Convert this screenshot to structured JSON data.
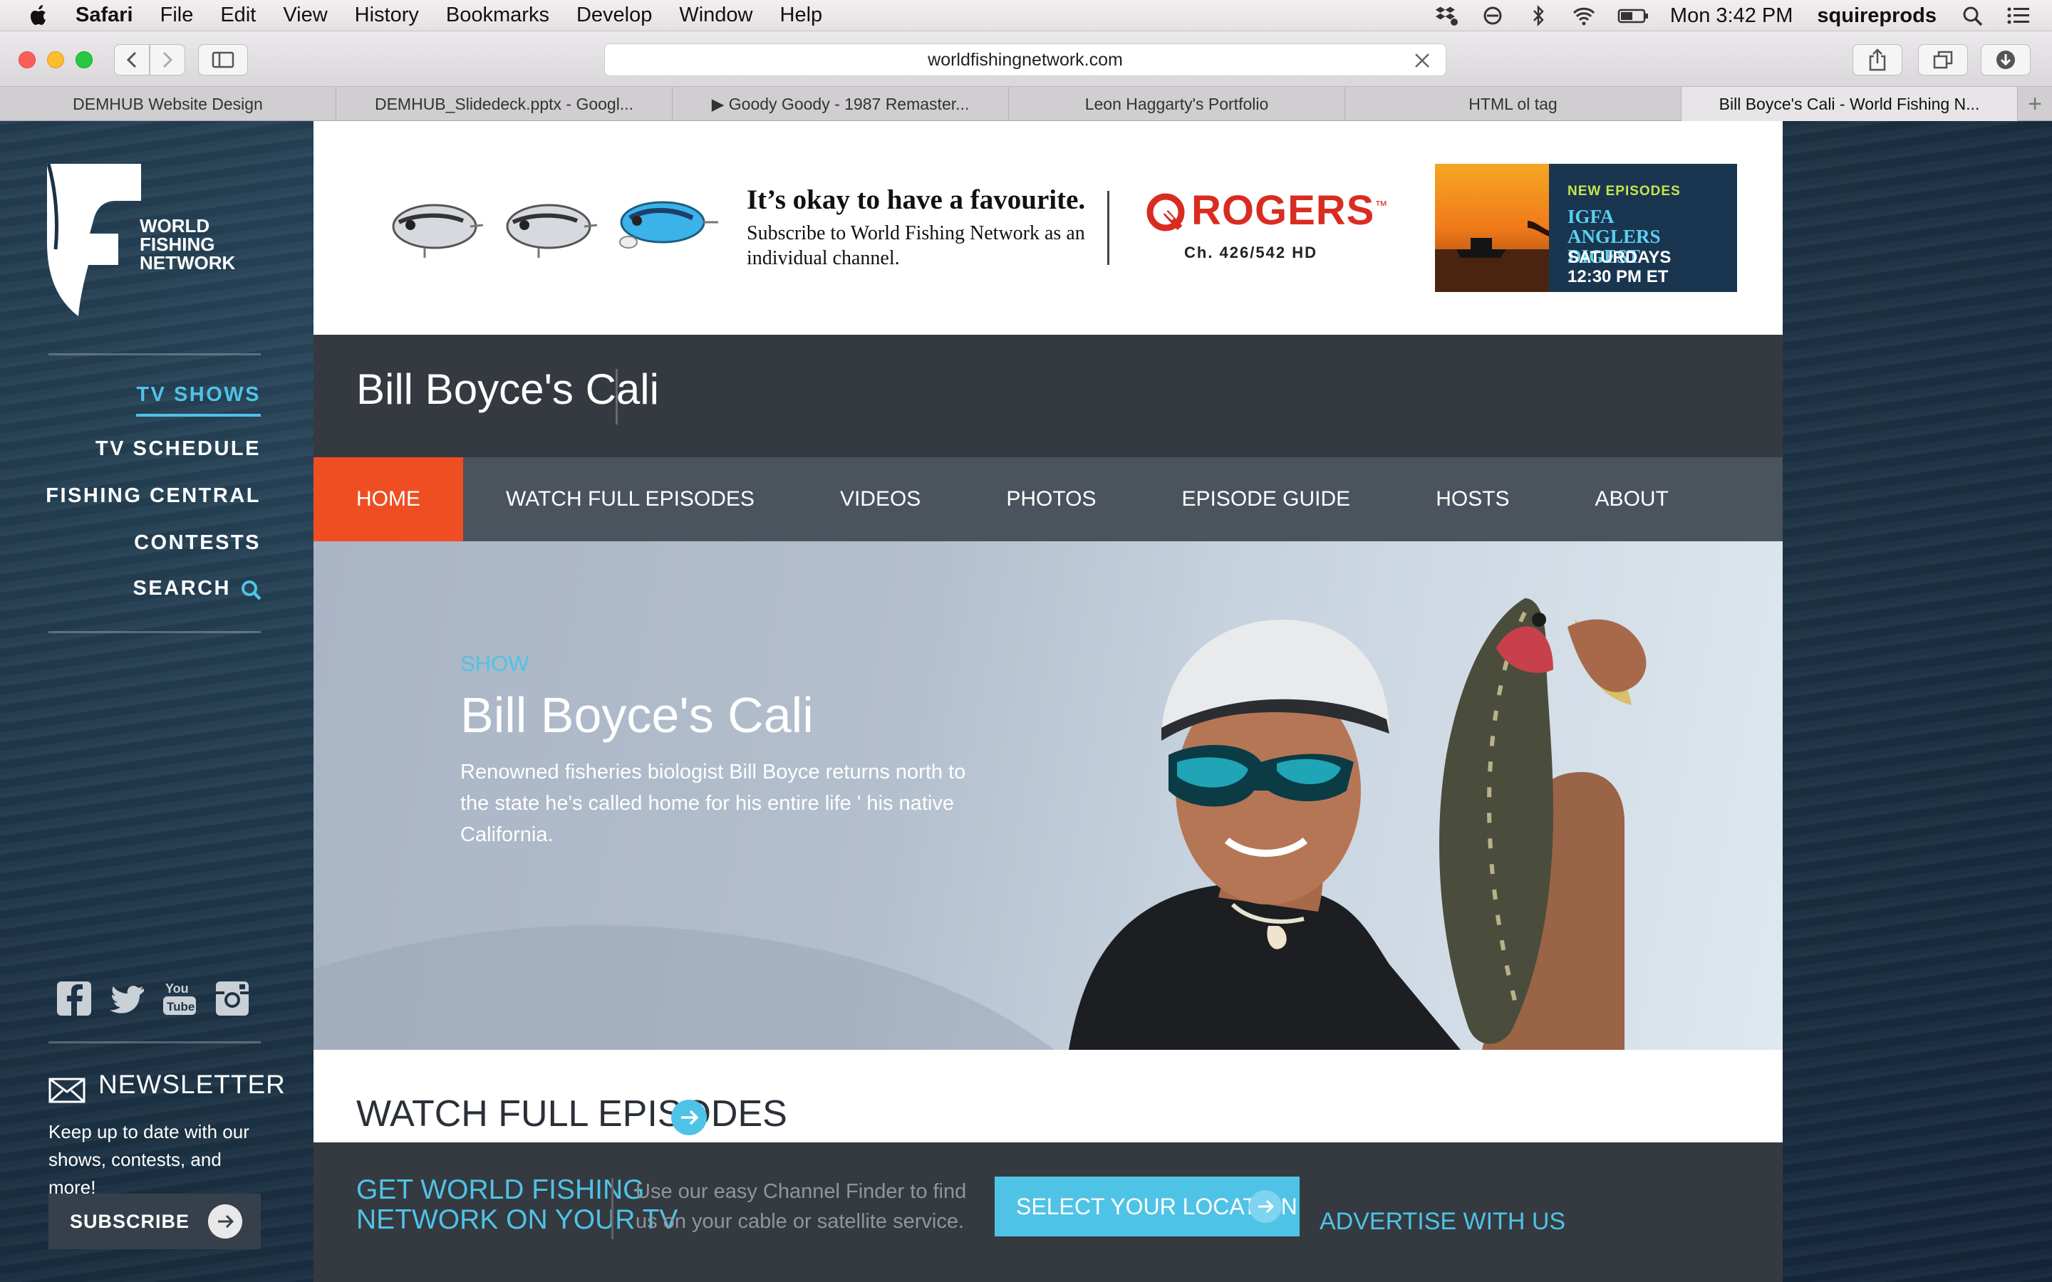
{
  "menubar": {
    "app": "Safari",
    "items": [
      "File",
      "Edit",
      "View",
      "History",
      "Bookmarks",
      "Develop",
      "Window",
      "Help"
    ],
    "clock": "Mon 3:42 PM",
    "user": "squireprods"
  },
  "browser": {
    "url": "worldfishingnetwork.com",
    "tabs": [
      "DEMHUB Website Design",
      "DEMHUB_Slidedeck.pptx - Googl...",
      "▶ Goody Goody - 1987 Remaster...",
      "Leon Haggarty's Portfolio",
      "HTML ol tag",
      "Bill Boyce's Cali - World Fishing N..."
    ],
    "new_tab": "+"
  },
  "sidebar": {
    "logo_text": [
      "WORLD",
      "FISHING",
      "NETWORK"
    ],
    "nav": [
      "TV SHOWS",
      "TV SCHEDULE",
      "FISHING CENTRAL",
      "CONTESTS",
      "SEARCH"
    ],
    "newsletter_title": "NEWSLETTER",
    "newsletter_text": "Keep up to date with our shows, contests, and more!",
    "subscribe_label": "SUBSCRIBE"
  },
  "banner": {
    "headline": "It’s okay to have a favourite.",
    "subline": "Subscribe to World Fishing Network as an individual channel.",
    "brand": "ROGERS",
    "brand_mark": "™",
    "channel": "Ch. 426/542 HD",
    "promo": {
      "line1": "NEW EPISODES",
      "line2": "IGFA",
      "line3": "ANGLERS DIGEST",
      "line4": "SATURDAYS",
      "line5": "12:30 PM ET"
    }
  },
  "show": {
    "title": "Bill Boyce's Cali",
    "nav": [
      "HOME",
      "WATCH FULL EPISODES",
      "VIDEOS",
      "PHOTOS",
      "EPISODE GUIDE",
      "HOSTS",
      "ABOUT"
    ],
    "hero_label": "SHOW",
    "hero_title": "Bill Boyce's Cali",
    "hero_desc": "Renowned fisheries biologist Bill Boyce returns north to the state he's called home for his entire life ' his native California.",
    "section_title": "WATCH FULL EPISODES"
  },
  "footer": {
    "get_tv_line1": "GET WORLD FISHING",
    "get_tv_line2": "NETWORK ON YOUR TV",
    "finder_text": "Use our easy Channel Finder to find us on your cable or satellite service.",
    "select_location": "SELECT YOUR LOCATION",
    "advertise": "ADVERTISE WITH US"
  },
  "colors": {
    "accent_blue": "#4fc3e6",
    "nav_active_orange": "#ef4e23",
    "rogers_red": "#d92c20",
    "header_dark": "#353a41"
  }
}
